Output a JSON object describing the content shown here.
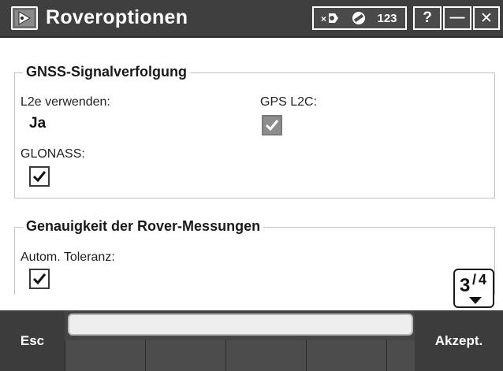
{
  "window": {
    "title": "Roveroptionen",
    "status_number": "123",
    "help_label": "?",
    "minimize_label": "—",
    "close_label": "✕"
  },
  "gnss": {
    "title": "GNSS-Signalverfolgung",
    "l2e_label": "L2e verwenden:",
    "l2e_value": "Ja",
    "gps_l2c_label": "GPS L2C:",
    "gps_l2c_checked": true,
    "glonass_label": "GLONASS:",
    "glonass_checked": true
  },
  "rover": {
    "title": "Genauigkeit der Rover-Messungen",
    "auto_tolerance_label": "Autom. Toleranz:",
    "auto_tolerance_checked": true
  },
  "pager": {
    "current": "3",
    "separator": "/",
    "total": "4"
  },
  "softkeys": {
    "esc_label": "Esc",
    "accept_label": "Akzept."
  },
  "message_area": {
    "text": ""
  }
}
